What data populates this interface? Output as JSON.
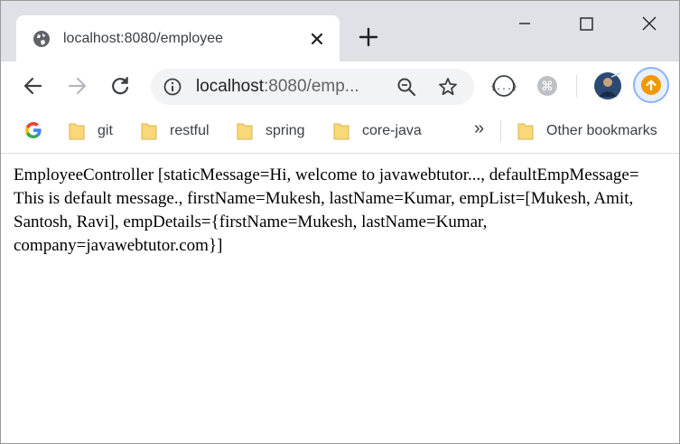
{
  "tab": {
    "title": "localhost:8080/employee"
  },
  "omnibox": {
    "host": "localhost",
    "path": ":8080/emp..."
  },
  "bookmarks": {
    "items": [
      {
        "label": "git"
      },
      {
        "label": "restful"
      },
      {
        "label": "spring"
      },
      {
        "label": "core-java"
      }
    ],
    "overflow": "»",
    "other": "Other bookmarks"
  },
  "page": {
    "text": "EmployeeController [staticMessage=Hi, welcome to javawebtutor..., defaultEmpMessage= This is default message., firstName=Mukesh, lastName=Kumar, empList=[Mukesh, Amit, Santosh, Ravi], empDetails={firstName=Mukesh, lastName=Kumar, company=javawebtutor.com}]"
  },
  "colors": {
    "titlebar": "#dee1e6",
    "omnibox": "#f1f3f4",
    "folder": "#f9d877",
    "update_badge": "#f29900"
  },
  "icons": [
    "globe-icon",
    "close-icon",
    "plus-icon",
    "minimize-icon",
    "maximize-icon",
    "back-arrow-icon",
    "forward-arrow-icon",
    "reload-icon",
    "info-icon",
    "zoom-out-icon",
    "star-icon",
    "extension-icon",
    "profile-avatar-icon",
    "update-icon",
    "google-icon",
    "folder-icon"
  ]
}
